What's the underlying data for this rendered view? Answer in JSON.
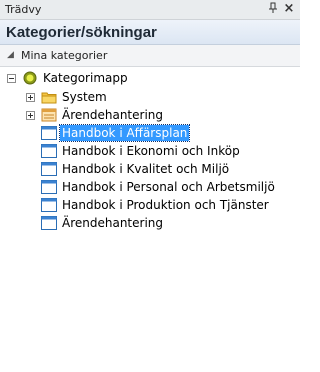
{
  "window": {
    "title": "Trädvy"
  },
  "header": {
    "title": "Kategorier/sökningar"
  },
  "group": {
    "label": "Mina kategorier"
  },
  "tree": {
    "root": {
      "label": "Kategorimapp"
    },
    "folders": [
      {
        "label": "System"
      },
      {
        "label": "Ärendehantering"
      }
    ],
    "items": [
      {
        "label": "Handbok i Affärsplan",
        "selected": true
      },
      {
        "label": "Handbok i Ekonomi och Inköp"
      },
      {
        "label": "Handbok i Kvalitet och Miljö"
      },
      {
        "label": "Handbok i Personal och Arbetsmiljö"
      },
      {
        "label": "Handbok i Produktion och Tjänster"
      },
      {
        "label": "Ärendehantering"
      }
    ]
  },
  "colors": {
    "selection": "#3399ff",
    "header_text": "#1f2a36"
  }
}
